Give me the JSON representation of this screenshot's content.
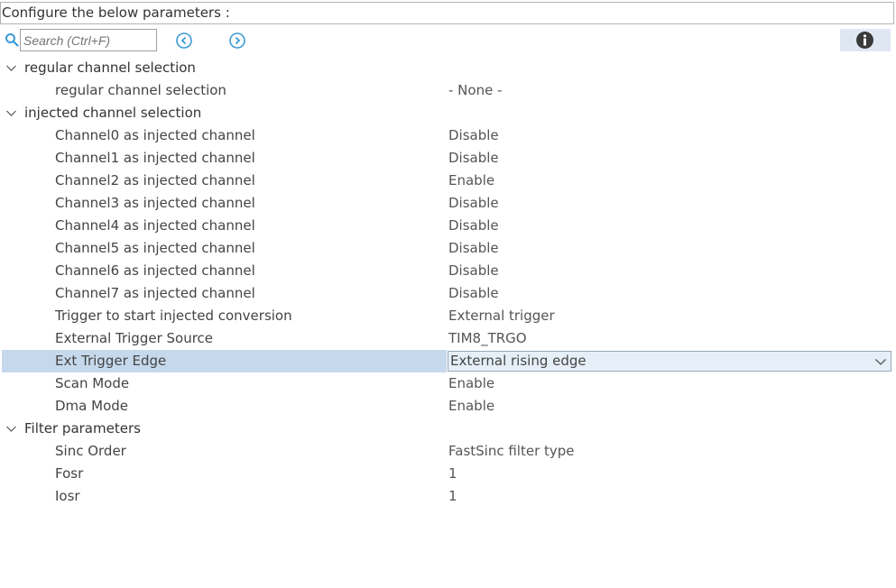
{
  "header": {
    "title": "Configure the below parameters :"
  },
  "toolbar": {
    "search_placeholder": "Search (Ctrl+F)",
    "accent_color": "#3d9ad6"
  },
  "groups": [
    {
      "label": "regular channel selection",
      "expanded": true,
      "params": [
        {
          "label": "regular channel selection",
          "value": "- None -"
        }
      ]
    },
    {
      "label": "injected channel selection",
      "expanded": true,
      "params": [
        {
          "label": "Channel0 as injected channel",
          "value": "Disable"
        },
        {
          "label": "Channel1 as injected channel",
          "value": "Disable"
        },
        {
          "label": "Channel2 as injected channel",
          "value": "Enable"
        },
        {
          "label": "Channel3 as injected channel",
          "value": "Disable"
        },
        {
          "label": "Channel4 as injected channel",
          "value": "Disable"
        },
        {
          "label": "Channel5 as injected channel",
          "value": "Disable"
        },
        {
          "label": "Channel6 as injected channel",
          "value": "Disable"
        },
        {
          "label": "Channel7 as injected channel",
          "value": "Disable"
        },
        {
          "label": "Trigger to start injected conversion",
          "value": "External trigger"
        },
        {
          "label": "External Trigger Source",
          "value": "TIM8_TRGO"
        },
        {
          "label": "Ext Trigger Edge",
          "value": "External rising edge",
          "selected": true
        },
        {
          "label": "Scan Mode",
          "value": "Enable"
        },
        {
          "label": "Dma Mode",
          "value": "Enable"
        }
      ]
    },
    {
      "label": "Filter parameters",
      "expanded": true,
      "params": [
        {
          "label": "Sinc Order",
          "value": "FastSinc filter type"
        },
        {
          "label": "Fosr",
          "value": "1"
        },
        {
          "label": "Iosr",
          "value": "1"
        }
      ]
    }
  ]
}
